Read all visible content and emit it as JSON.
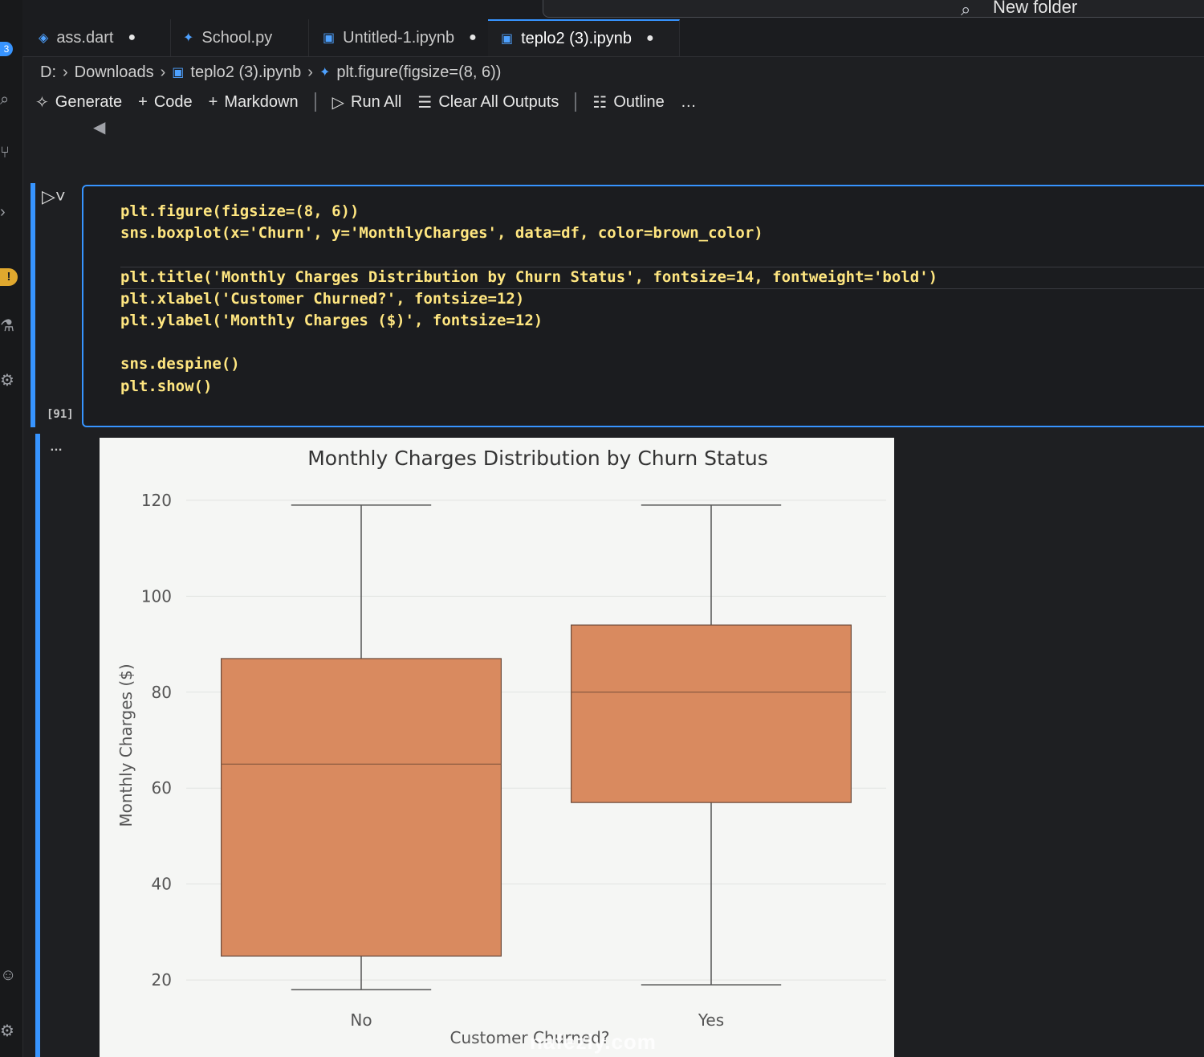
{
  "command_center": {
    "search_text": "New folder"
  },
  "activity_bar": {
    "badge_count": "3"
  },
  "tabs": [
    {
      "label": "ass.dart",
      "icon": "dart-file-icon",
      "dirty": true
    },
    {
      "label": "School.py",
      "icon": "python-file-icon",
      "dirty": false
    },
    {
      "label": "Untitled-1.ipynb",
      "icon": "notebook-file-icon",
      "dirty": true
    },
    {
      "label": "teplo2 (3).ipynb",
      "icon": "notebook-file-icon",
      "dirty": true,
      "active": true
    }
  ],
  "breadcrumb": {
    "drive": "D:",
    "folder": "Downloads",
    "file": "teplo2 (3).ipynb",
    "symbol": "plt.figure(figsize=(8, 6))"
  },
  "toolbar": {
    "generate": "Generate",
    "code": "Code",
    "markdown": "Markdown",
    "run_all": "Run All",
    "clear_all_outputs": "Clear All Outputs",
    "outline": "Outline",
    "more": "…"
  },
  "cell": {
    "execution_count": "[91]",
    "more_actions": "…"
  },
  "code": [
    "plt.figure(figsize=(8, 6))",
    "sns.boxplot(x='Churn', y='MonthlyCharges', data=df, color=brown_color)",
    "",
    "plt.title('Monthly Charges Distribution by Churn Status', fontsize=14, fontweight='bold')",
    "plt.xlabel('Customer Churned?', fontsize=12)",
    "plt.ylabel('Monthly Charges ($)', fontsize=12)",
    "",
    "sns.despine()",
    "plt.show()"
  ],
  "chart_data": {
    "type": "box",
    "title": "Monthly Charges Distribution by Churn Status",
    "xlabel": "Customer Churned?",
    "ylabel": "Monthly Charges ($)",
    "categories": [
      "No",
      "Yes"
    ],
    "boxes": [
      {
        "category": "No",
        "whisker_low": 18,
        "q1": 25,
        "median": 65,
        "q3": 87,
        "whisker_high": 119
      },
      {
        "category": "Yes",
        "whisker_low": 19,
        "q1": 57,
        "median": 80,
        "q3": 94,
        "whisker_high": 119
      }
    ],
    "ylim": [
      15,
      125
    ],
    "yticks": [
      20,
      40,
      60,
      80,
      100,
      120
    ],
    "grid": true,
    "box_color": "#d98a5f"
  },
  "watermark": "nafezly.com"
}
